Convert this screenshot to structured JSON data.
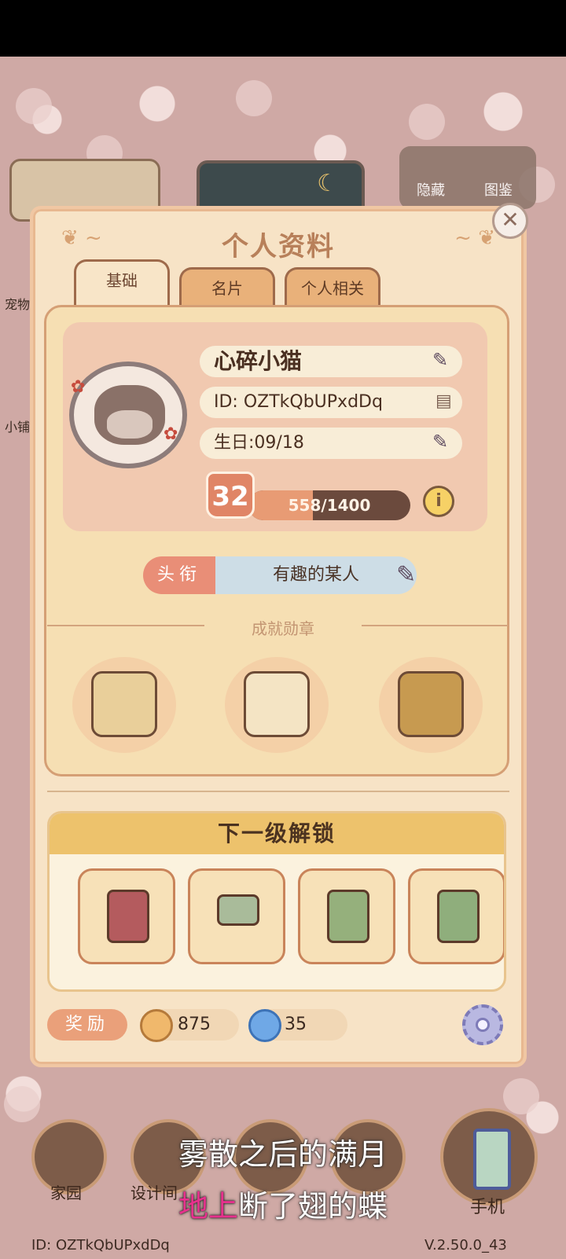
{
  "dialog": {
    "title": "个人资料",
    "tabs": [
      {
        "label": "基础"
      },
      {
        "label": "名片"
      },
      {
        "label": "个人相关"
      }
    ]
  },
  "profile": {
    "name": "心碎小猫",
    "id_text": "ID: OZTkQbUPxdDq",
    "birthday": "生日:09/18",
    "level": "32",
    "exp_text": "558/1400",
    "exp_fraction": 0.399
  },
  "title_row": {
    "tag": "头衔",
    "value": "有趣的某人"
  },
  "achievements": {
    "heading": "成就勋章",
    "badges": [
      "coin-bag-icon",
      "envelope-icon",
      "stamp-icon"
    ]
  },
  "unlock": {
    "heading": "下一级解锁",
    "items": [
      "jar-icon",
      "stool-icon",
      "cabinet-icon",
      "wardrobe-icon"
    ]
  },
  "rewards": {
    "label": "奖励",
    "coins": "875",
    "swirl": "35"
  },
  "hud": {
    "hide_label": "隐藏",
    "catalog_label": "图鉴",
    "side_label_1": "宠物",
    "side_label_2": "小铺"
  },
  "bottom_nav": {
    "home": "家园",
    "design": "设计间",
    "phone": "手机",
    "footer_id": "ID: OZTkQbUPxdDq",
    "version": "V.2.50.0_43"
  },
  "lyrics": {
    "line1": "雾散之后的满月",
    "line2_pink": "地上",
    "line2_rest": "断了翅的蝶"
  },
  "colors": {
    "dialog_bg": "#f7e3c6",
    "accent_orange": "#e9b17a",
    "title_tag": "#e98e77",
    "unlock_header": "#edc26c"
  }
}
